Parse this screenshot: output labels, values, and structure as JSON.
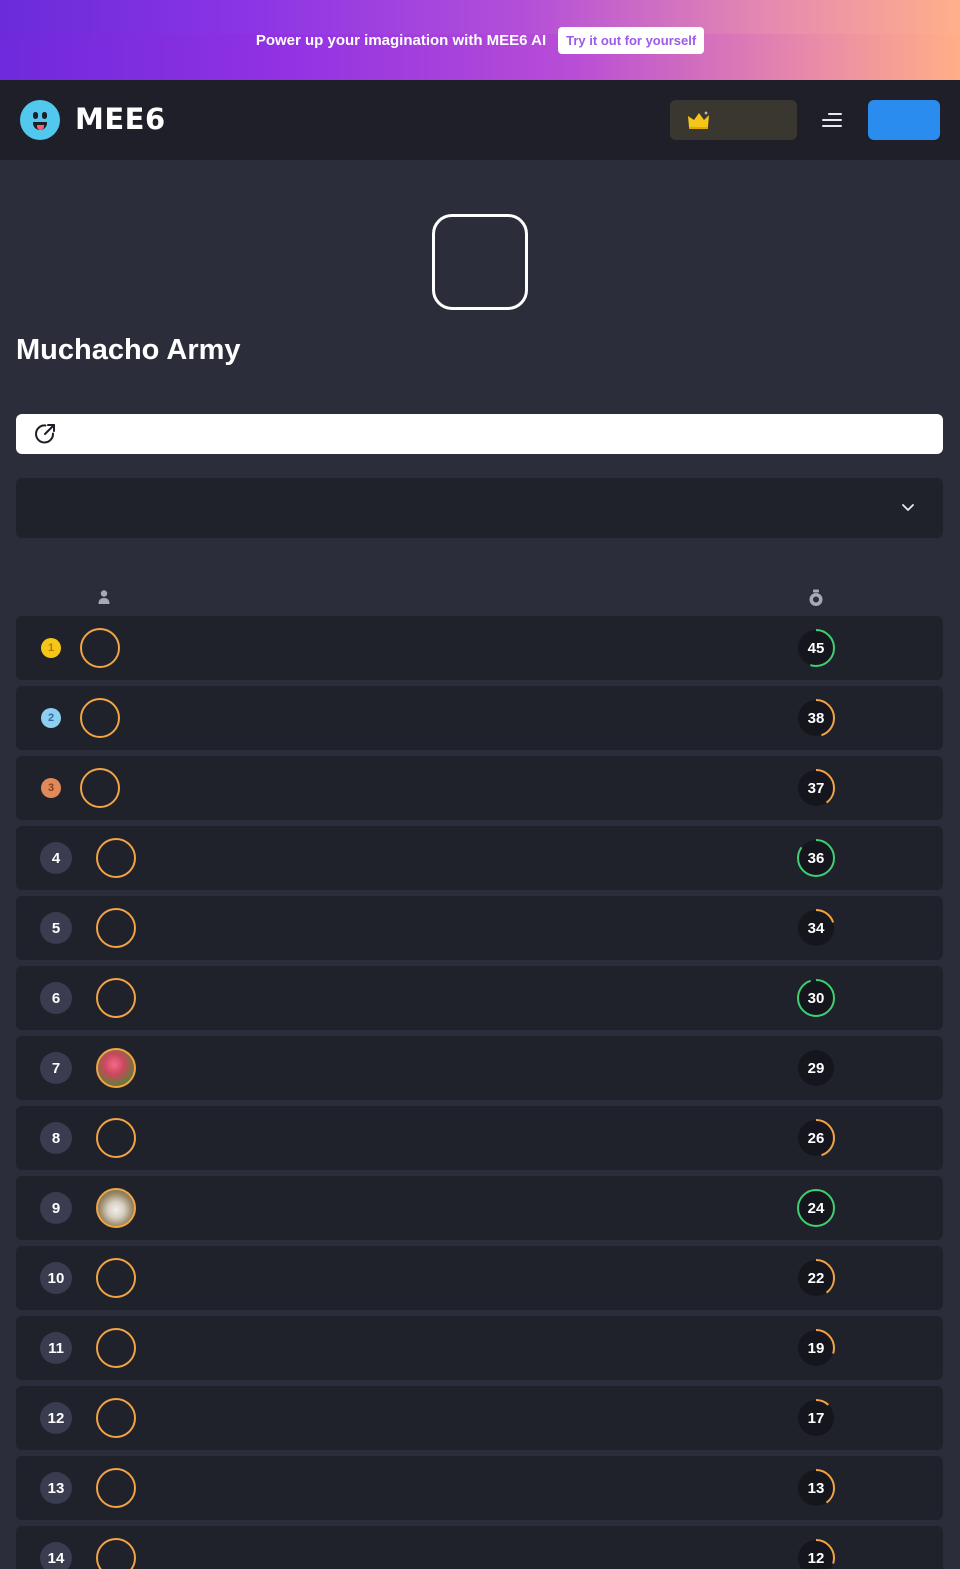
{
  "promo": {
    "text": "Power up your imagination with MEE6 AI",
    "button": "Try it out for yourself"
  },
  "header": {
    "brand": "MEE6",
    "premium_icon": "crown-icon",
    "menu_icon": "menu-icon"
  },
  "server": {
    "name": "Muchacho Army",
    "share_icon": "share-icon",
    "dropdown_icon": "chevron-down-icon"
  },
  "columns": {
    "user_icon": "user-icon",
    "level_icon": "level-icon"
  },
  "colors": {
    "accent_green": "#3ecf73",
    "accent_orange": "#f2a344",
    "gold": "#f5c518",
    "silver": "#8ccff0",
    "bronze": "#e0895a"
  },
  "leaderboard": [
    {
      "rank": "1",
      "medal": "gold",
      "avatar": "empty",
      "level": "45",
      "progress": 0.55,
      "ring": "green"
    },
    {
      "rank": "2",
      "medal": "silver",
      "avatar": "empty",
      "level": "38",
      "progress": 0.45,
      "ring": "orange"
    },
    {
      "rank": "3",
      "medal": "bronze",
      "avatar": "empty",
      "level": "37",
      "progress": 0.4,
      "ring": "orange"
    },
    {
      "rank": "4",
      "medal": "",
      "avatar": "empty",
      "level": "36",
      "progress": 0.85,
      "ring": "green"
    },
    {
      "rank": "5",
      "medal": "",
      "avatar": "empty",
      "level": "34",
      "progress": 0.2,
      "ring": "orange"
    },
    {
      "rank": "6",
      "medal": "",
      "avatar": "empty",
      "level": "30",
      "progress": 0.95,
      "ring": "green"
    },
    {
      "rank": "7",
      "medal": "",
      "avatar": "photo-flowers",
      "level": "29",
      "progress": 0.0,
      "ring": "orange"
    },
    {
      "rank": "8",
      "medal": "",
      "avatar": "empty",
      "level": "26",
      "progress": 0.45,
      "ring": "orange"
    },
    {
      "rank": "9",
      "medal": "",
      "avatar": "photo-dog",
      "level": "24",
      "progress": 1.0,
      "ring": "green"
    },
    {
      "rank": "10",
      "medal": "",
      "avatar": "empty",
      "level": "22",
      "progress": 0.4,
      "ring": "orange"
    },
    {
      "rank": "11",
      "medal": "",
      "avatar": "empty",
      "level": "19",
      "progress": 0.3,
      "ring": "orange"
    },
    {
      "rank": "12",
      "medal": "",
      "avatar": "empty",
      "level": "17",
      "progress": 0.12,
      "ring": "orange"
    },
    {
      "rank": "13",
      "medal": "",
      "avatar": "empty",
      "level": "13",
      "progress": 0.4,
      "ring": "orange"
    },
    {
      "rank": "14",
      "medal": "",
      "avatar": "empty",
      "level": "12",
      "progress": 0.3,
      "ring": "orange"
    }
  ]
}
